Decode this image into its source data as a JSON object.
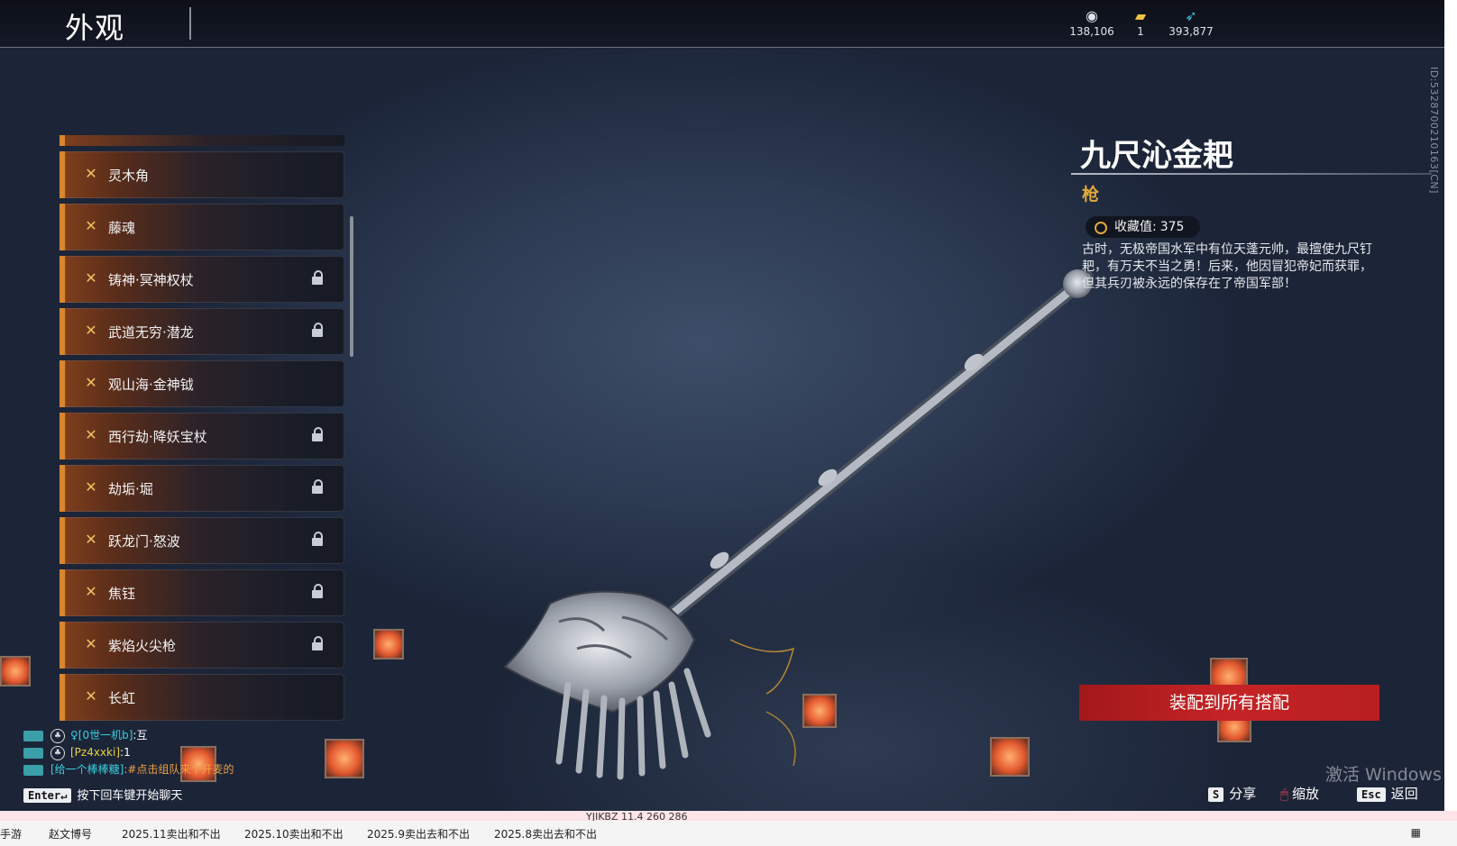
{
  "header": {
    "title": "外观",
    "currencies": [
      {
        "icon": "silver-coin-icon",
        "value": "138,106"
      },
      {
        "icon": "ticket-icon",
        "value": "1"
      },
      {
        "icon": "feather-icon",
        "value": "393,877"
      }
    ]
  },
  "list": {
    "items": [
      {
        "label": "灵木角",
        "locked": false
      },
      {
        "label": "藤魂",
        "locked": false
      },
      {
        "label": "铸神·冥神权杖",
        "locked": true
      },
      {
        "label": "武道无穷·潜龙",
        "locked": true
      },
      {
        "label": "观山海·金神钺",
        "locked": false
      },
      {
        "label": "西行劫·降妖宝杖",
        "locked": true
      },
      {
        "label": "劫垢·堀",
        "locked": true
      },
      {
        "label": "跃龙门·怒波",
        "locked": true
      },
      {
        "label": "焦钰",
        "locked": true
      },
      {
        "label": "紫焰火尖枪",
        "locked": true
      },
      {
        "label": "长虹",
        "locked": false
      }
    ]
  },
  "detail": {
    "name": "九尺沁金耙",
    "type": "枪",
    "collect_label": "收藏值:",
    "collect_value": "375",
    "description": "古时，无极帝国水军中有位天蓬元帅，最擅使九尺钉耙，有万夫不当之勇！后来，他因冒犯帝妃而获罪，但其兵刃被永远的保存在了帝国军部！",
    "equip_button": "装配到所有搭配",
    "vertical_id": "ID:5328700210163[CN]"
  },
  "chat": {
    "lines": [
      {
        "name": "♀[0世一机b]",
        "text": ":互"
      },
      {
        "name": "[Pz4xxki]",
        "text": ":1"
      },
      {
        "name": "[给一个棒棒糖]",
        "text": ":#点击组队来个开麦的"
      }
    ],
    "enter_key": "Enter↵",
    "hint": "按下回车键开始聊天"
  },
  "footer_hints": [
    {
      "key": "S",
      "label": "分享"
    },
    {
      "key": "🖱",
      "label": "缩放"
    },
    {
      "key": "Esc",
      "label": "返回"
    }
  ],
  "watermark": "激活 Windows",
  "taskbar": {
    "tabs": [
      "手游",
      "赵文博号",
      "2025.11卖出和不出",
      "2025.10卖出和不出",
      "2025.9卖出去和不出",
      "2025.8卖出去和不出"
    ],
    "sheet_row": "YJIKBZ        11.4      260      286"
  }
}
